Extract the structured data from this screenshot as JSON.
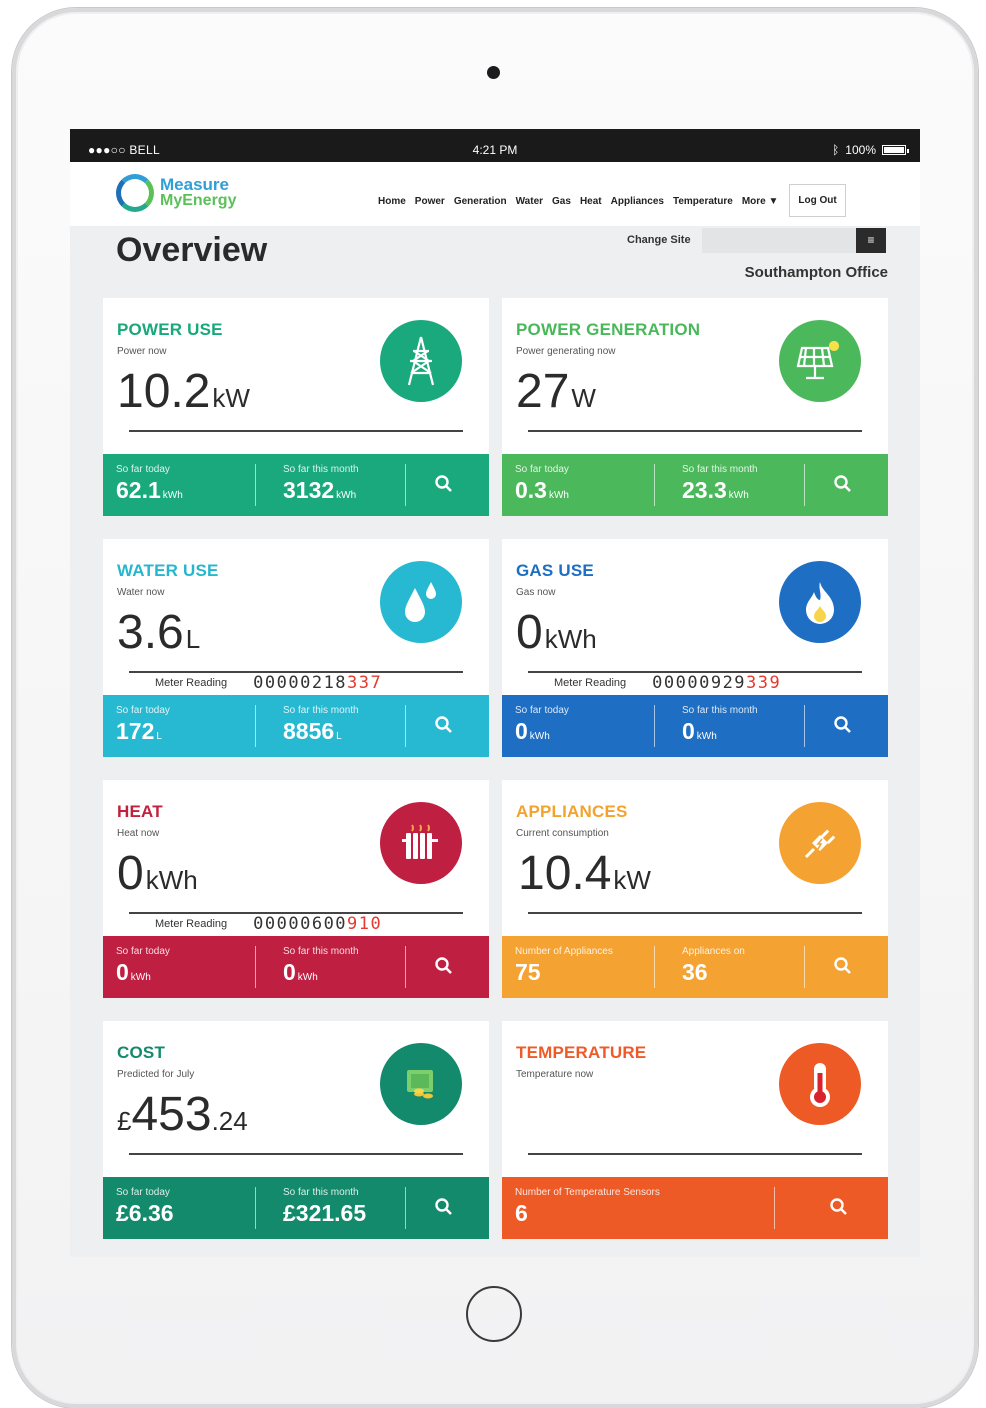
{
  "status_bar": {
    "carrier": "●●●○○ BELL",
    "time": "4:21 PM",
    "battery": "100%"
  },
  "brand": {
    "line1": "Measure",
    "line2": "MyEnergy"
  },
  "nav": {
    "items": [
      "Home",
      "Power",
      "Generation",
      "Water",
      "Gas",
      "Heat",
      "Appliances",
      "Temperature",
      "More ▼"
    ],
    "logout": "Log Out"
  },
  "page": {
    "title": "Overview",
    "change_site_label": "Change Site",
    "site_input_value": "",
    "site_name": "Southampton Office"
  },
  "cards": {
    "power": {
      "title": "POWER USE",
      "subtitle": "Power now",
      "value": "10.2",
      "unit": "kW",
      "cells": [
        {
          "label": "So far today",
          "value": "62.1",
          "unit": "kWh"
        },
        {
          "label": "So far this month",
          "value": "3132",
          "unit": "kWh"
        }
      ]
    },
    "generation": {
      "title": "POWER GENERATION",
      "subtitle": "Power generating now",
      "value": "27",
      "unit": "W",
      "cells": [
        {
          "label": "So far today",
          "value": "0.3",
          "unit": "kWh"
        },
        {
          "label": "So far this month",
          "value": "23.3",
          "unit": "kWh"
        }
      ]
    },
    "water": {
      "title": "WATER USE",
      "subtitle": "Water now",
      "value": "3.6",
      "unit": "L",
      "meter_label": "Meter Reading",
      "meter_black": "00000218",
      "meter_red": "337",
      "cells": [
        {
          "label": "So far today",
          "value": "172",
          "unit": "L"
        },
        {
          "label": "So far this month",
          "value": "8856",
          "unit": "L"
        }
      ]
    },
    "gas": {
      "title": "GAS USE",
      "subtitle": "Gas now",
      "value": "0",
      "unit": "kWh",
      "meter_label": "Meter Reading",
      "meter_black": "00000929",
      "meter_red": "339",
      "cells": [
        {
          "label": "So far today",
          "value": "0",
          "unit": "kWh"
        },
        {
          "label": "So far this month",
          "value": "0",
          "unit": "kWh"
        }
      ]
    },
    "heat": {
      "title": "HEAT",
      "subtitle": "Heat now",
      "value": "0",
      "unit": "kWh",
      "meter_label": "Meter Reading",
      "meter_black": "00000600",
      "meter_red": "910",
      "cells": [
        {
          "label": "So far today",
          "value": "0",
          "unit": "kWh"
        },
        {
          "label": "So far this month",
          "value": "0",
          "unit": "kWh"
        }
      ]
    },
    "appliances": {
      "title": "APPLIANCES",
      "subtitle": "Current consumption",
      "value": "10.4",
      "unit": "kW",
      "cells": [
        {
          "label": "Number of Appliances",
          "value": "75"
        },
        {
          "label": "Appliances on",
          "value": "36"
        }
      ]
    },
    "cost": {
      "title": "COST",
      "subtitle": "Predicted for July",
      "currency": "£",
      "value": "453",
      "decimal": ".24",
      "cells": [
        {
          "label": "So far today",
          "value": "£6.36"
        },
        {
          "label": "So far this month",
          "value": "£321.65"
        }
      ]
    },
    "temperature": {
      "title": "TEMPERATURE",
      "subtitle": "Temperature now",
      "cells": [
        {
          "label": "Number of Temperature Sensors",
          "value": "6"
        }
      ]
    }
  },
  "colors": {
    "power": "#1aa97c",
    "generation": "#4cb85c",
    "water": "#27b9d1",
    "gas": "#1e6ec3",
    "heat": "#bf1f41",
    "appliances": "#f4a232",
    "cost": "#138a6c",
    "temperature": "#ee5a25"
  },
  "icons": {
    "power": "power-pylon-icon",
    "generation": "solar-panel-icon",
    "water": "water-drops-icon",
    "gas": "flame-icon",
    "heat": "radiator-icon",
    "appliances": "plug-icon",
    "cost": "money-icon",
    "temperature": "thermometer-icon",
    "search": "search-icon"
  }
}
